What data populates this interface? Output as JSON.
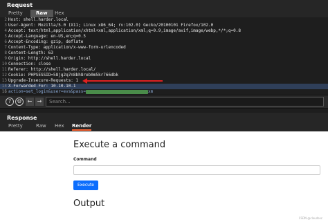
{
  "request": {
    "title": "Request",
    "tabs": [
      {
        "label": "Pretty"
      },
      {
        "label": "Raw"
      },
      {
        "label": "Hex"
      }
    ],
    "active_tab": "Raw",
    "lines": [
      {
        "num": "2",
        "text": "Host: shell.harder.local"
      },
      {
        "num": "3",
        "text": "User-Agent: Mozilla/5.0 (X11; Linux x86_64; rv:102.0) Gecko/20100101 Firefox/102.0"
      },
      {
        "num": "4",
        "text": "Accept: text/html,application/xhtml+xml,application/xml;q=0.9,image/avif,image/webp,*/*;q=0.8"
      },
      {
        "num": "5",
        "text": "Accept-Language: en-US,en;q=0.5"
      },
      {
        "num": "6",
        "text": "Accept-Encoding: gzip, deflate"
      },
      {
        "num": "7",
        "text": "Content-Type: application/x-www-form-urlencoded"
      },
      {
        "num": "8",
        "text": "Content-Length: 63"
      },
      {
        "num": "9",
        "text": "Origin: http://shell.harder.local"
      },
      {
        "num": "10",
        "text": "Connection: close"
      },
      {
        "num": "11",
        "text": "Referer: http://shell.harder.local/"
      },
      {
        "num": "12",
        "text": "Cookie: PHPSESSID=58jg2q7n8bh8reb0m5kr766dbk"
      },
      {
        "num": "13",
        "text": "Upgrade-Insecure-Requests: 1"
      },
      {
        "num": "14",
        "text": "X-Forwarded-For: 10.10.10.1"
      },
      {
        "num": "15",
        "text": ""
      },
      {
        "num": "16",
        "text": "action=set_login&user=evs&pass="
      }
    ],
    "last_line_suffix": "xm",
    "search_placeholder": "Search..."
  },
  "toolbar": {
    "help_icon": "?",
    "settings_icon": "⚙",
    "back_icon": "←",
    "forward_icon": "→"
  },
  "response": {
    "title": "Response",
    "tabs": [
      {
        "label": "Pretty"
      },
      {
        "label": "Raw"
      },
      {
        "label": "Hex"
      },
      {
        "label": "Render"
      }
    ],
    "active_tab": "Render",
    "render": {
      "heading": "Execute a command",
      "field_label": "Command",
      "field_value": "",
      "button_label": "Execute",
      "output_heading": "Output",
      "watermark": "CSDN @cloudsec"
    }
  },
  "colors": {
    "accent": "#ff6633",
    "button": "#0d6efd",
    "arrow": "#e02020",
    "selection": "#2f3f59"
  }
}
